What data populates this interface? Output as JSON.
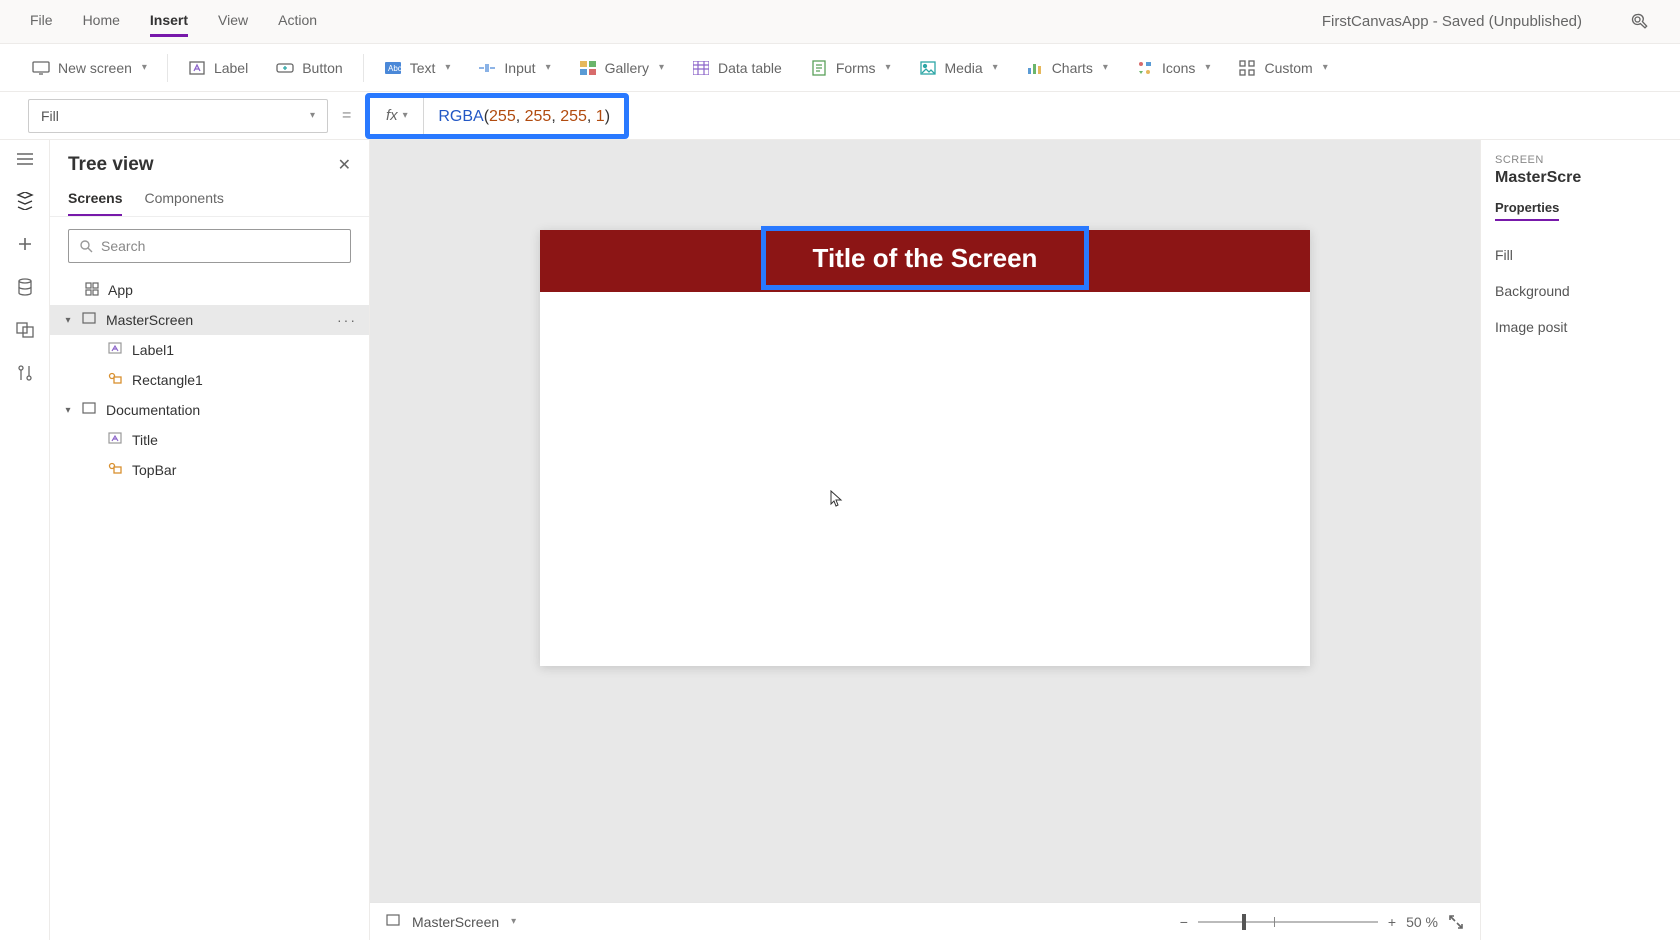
{
  "menubar": {
    "items": [
      "File",
      "Home",
      "Insert",
      "View",
      "Action"
    ],
    "active": "Insert",
    "app_title": "FirstCanvasApp - Saved (Unpublished)"
  },
  "ribbon": {
    "new_screen": "New screen",
    "label": "Label",
    "button": "Button",
    "text": "Text",
    "input": "Input",
    "gallery": "Gallery",
    "data_table": "Data table",
    "forms": "Forms",
    "media": "Media",
    "charts": "Charts",
    "icons": "Icons",
    "custom": "Custom"
  },
  "formula": {
    "property": "Fill",
    "fn": "RGBA",
    "args_display": "(255, 255, 255, 1)",
    "args": [
      255,
      255,
      255,
      1
    ]
  },
  "tree": {
    "title": "Tree view",
    "tabs": {
      "screens": "Screens",
      "components": "Components"
    },
    "search_placeholder": "Search",
    "nodes": {
      "app": "App",
      "masterscreen": "MasterScreen",
      "label1": "Label1",
      "rectangle1": "Rectangle1",
      "documentation": "Documentation",
      "title": "Title",
      "topbar": "TopBar"
    }
  },
  "canvas": {
    "title_text": "Title of the Screen",
    "colors": {
      "topbar": "#8c1515",
      "highlight": "#2979ff"
    },
    "footer_name": "MasterScreen",
    "zoom": "50 %"
  },
  "props": {
    "section": "SCREEN",
    "name": "MasterScre",
    "tab": "Properties",
    "rows": [
      "Fill",
      "Background",
      "Image posit"
    ]
  }
}
